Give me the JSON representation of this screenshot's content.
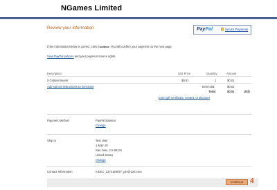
{
  "header": {
    "merchant_name": "NGames Limited"
  },
  "page_title": "Review your information",
  "paypal": {
    "logo_pay": "Pay",
    "logo_pal": "Pal",
    "secure_label": "Secure Payments"
  },
  "intro": {
    "before": "If the information below is correct, click ",
    "strong": "Continue",
    "after": ". You will confirm your payment on the next page."
  },
  "policies": {
    "link": "View PayPal policies",
    "suffix": " and your payment source rights."
  },
  "table": {
    "headers": {
      "description": "Description",
      "unit_price": "Unit Price",
      "quantity": "Quantity",
      "amount": "Amount"
    },
    "item": {
      "description": "0 Golden Beans",
      "unit_price": "$0.01",
      "quantity": "1",
      "amount": "$0.01"
    },
    "special_instructions": "Add special instructions to merchant",
    "item_total_label": "Item total:",
    "item_total": "$0.01",
    "total_label": "Total:",
    "total": "$0.01",
    "currency": "USD",
    "gift_link": "Enter gift certificate, reward, or discount"
  },
  "payment_method": {
    "label": "Payment Method",
    "value": "PayPal Balance",
    "change": "Change"
  },
  "ship_to": {
    "label": "Ship to",
    "name": "Test User",
    "line1": "1 Main St",
    "line2": "San Jose, CA 95131",
    "country": "United States",
    "change": "Change"
  },
  "contact": {
    "label": "Contact Information",
    "email": "rushcc_1274169037_per@126.com"
  },
  "footer": {
    "continue_label": "Continue",
    "step_number": "4"
  },
  "colors": {
    "accent_orange": "#c45d0a",
    "link_blue": "#084b8a",
    "paypal_navy": "#1d3d83",
    "button_orange": "#e8a878"
  }
}
